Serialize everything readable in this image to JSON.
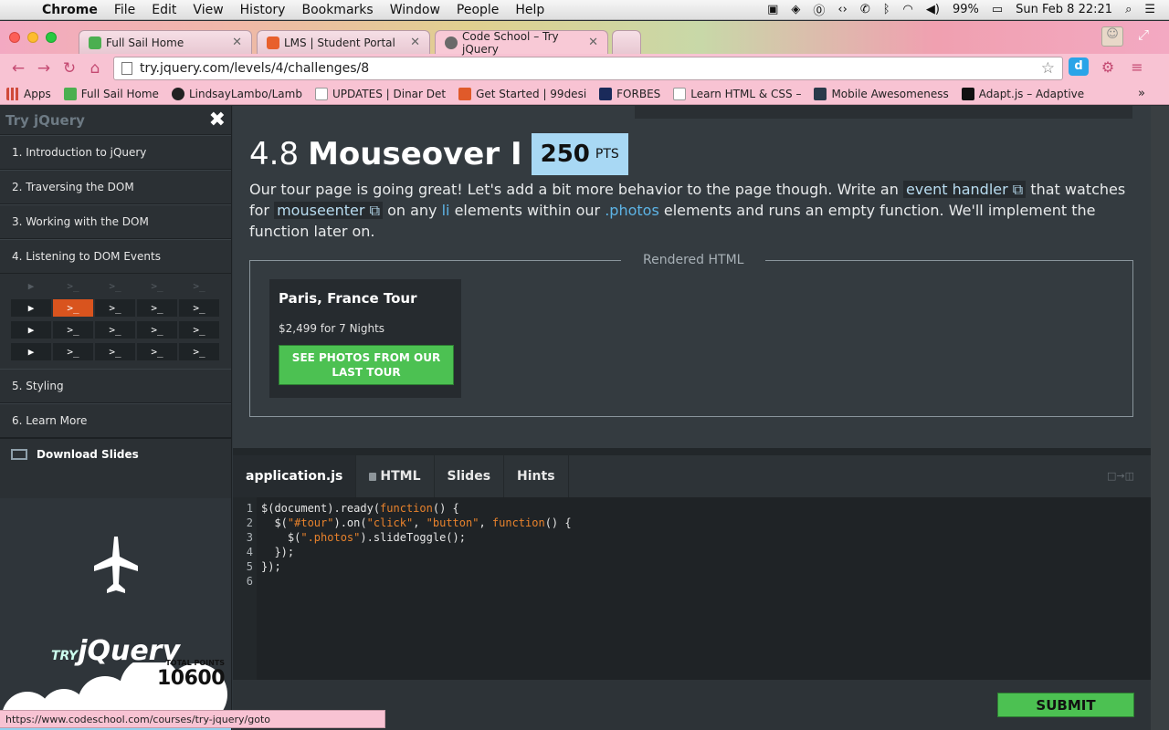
{
  "menubar": {
    "app": "Chrome",
    "items": [
      "File",
      "Edit",
      "View",
      "History",
      "Bookmarks",
      "Window",
      "People",
      "Help"
    ],
    "battery": "99%",
    "clock": "Sun Feb 8  22:21"
  },
  "tabs": [
    {
      "title": "Full Sail Home",
      "color": "#4caf50"
    },
    {
      "title": "LMS | Student Portal",
      "color": "#e8602c"
    },
    {
      "title": "Code School – Try jQuery",
      "color": "#6a6a6a"
    }
  ],
  "address": {
    "url": "try.jquery.com/levels/4/challenges/8"
  },
  "bookmarks": [
    {
      "label": "Apps",
      "color": "#d04a3a"
    },
    {
      "label": "Full Sail Home",
      "color": "#4caf50"
    },
    {
      "label": "LindsayLambo/Lamb",
      "color": "#222222"
    },
    {
      "label": "UPDATES | Dinar Det",
      "color": "#dddddd"
    },
    {
      "label": "Get Started | 99desi",
      "color": "#e05a2a"
    },
    {
      "label": "FORBES",
      "color": "#1a2a5a"
    },
    {
      "label": "Learn HTML & CSS –",
      "color": "#dddddd"
    },
    {
      "label": "Mobile Awesomeness",
      "color": "#2a3a4a"
    },
    {
      "label": "Adapt.js – Adaptive",
      "color": "#111111"
    }
  ],
  "sidebar": {
    "title": "Try jQuery",
    "levels": [
      {
        "label": "1. Introduction to jQuery"
      },
      {
        "label": "2. Traversing the DOM"
      },
      {
        "label": "3. Working with the DOM"
      },
      {
        "label": "4. Listening to DOM Events"
      }
    ],
    "levels_after": [
      {
        "label": "5. Styling"
      },
      {
        "label": "6. Learn More"
      }
    ],
    "download": "Download Slides",
    "promo_logo_small": "TRY",
    "promo_logo": "jQuery",
    "points_label": "TOTAL POINTS",
    "points": "10600"
  },
  "challenge": {
    "number": "4.8",
    "name": "Mouseover I",
    "points": "250",
    "points_unit": "PTS",
    "desc_1": "Our tour page is going great! Let's add a bit more behavior to the page though. Write an ",
    "link_1": "event handler",
    "desc_2": " that watches for ",
    "link_2": "mouseenter",
    "desc_3": " on any ",
    "hl_1": "li",
    "desc_4": " elements within our ",
    "hl_2": ".photos",
    "desc_5": " elements and runs an empty function. We'll implement the function later on."
  },
  "rendered": {
    "label": "Rendered HTML",
    "card_title": "Paris, France Tour",
    "card_price": "$2,499 for 7 Nights",
    "card_button": "SEE PHOTOS FROM OUR LAST TOUR"
  },
  "editor": {
    "tabs": [
      "application.js",
      "HTML",
      "Slides",
      "Hints"
    ],
    "line_numbers": [
      "1",
      "2",
      "3",
      "4",
      "5",
      "6"
    ],
    "submit": "SUBMIT"
  },
  "statusbar": {
    "url": "https://www.codeschool.com/courses/try-jquery/goto"
  }
}
